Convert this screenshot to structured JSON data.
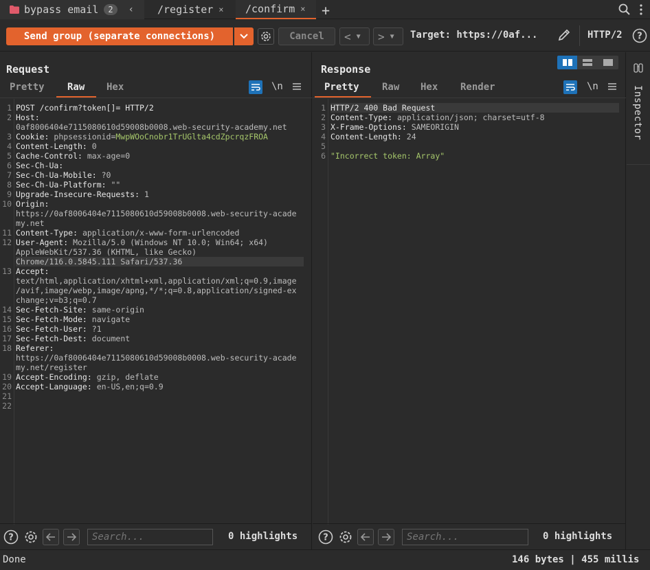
{
  "tabs": [
    {
      "label": "bypass email",
      "badge": "2"
    },
    {
      "label": "/register"
    },
    {
      "label": "/confirm"
    }
  ],
  "toolbar": {
    "send_label": "Send group (separate connections)",
    "cancel_label": "Cancel",
    "target_label": "Target: https://0af...",
    "http_version": "HTTP/2",
    "back_glyph": "<",
    "forward_glyph": ">"
  },
  "request": {
    "title": "Request",
    "subtabs": [
      "Pretty",
      "Raw",
      "Hex"
    ],
    "active_subtab": "Raw",
    "newline_toggle": "\\n",
    "lines": [
      {
        "n": "1",
        "k": "POST /confirm?token[]= HTTP/2",
        "v": ""
      },
      {
        "n": "2",
        "k": "Host:",
        "v": ""
      },
      {
        "n": "",
        "k": "",
        "v": "0af8006404e7115080610d59008b0008.web-security-academy.net"
      },
      {
        "n": "3",
        "k": "Cookie: ",
        "v": "phpsessionid=",
        "cv": "MwpWOoCnobr1TrUGlta4cdZpcrqzFROA"
      },
      {
        "n": "4",
        "k": "Content-Length: ",
        "v": "0"
      },
      {
        "n": "5",
        "k": "Cache-Control: ",
        "v": "max-age=0"
      },
      {
        "n": "6",
        "k": "Sec-Ch-Ua:",
        "v": ""
      },
      {
        "n": "7",
        "k": "Sec-Ch-Ua-Mobile: ",
        "v": "?0"
      },
      {
        "n": "8",
        "k": "Sec-Ch-Ua-Platform: ",
        "v": "\"\""
      },
      {
        "n": "9",
        "k": "Upgrade-Insecure-Requests: ",
        "v": "1"
      },
      {
        "n": "10",
        "k": "Origin:",
        "v": ""
      },
      {
        "n": "",
        "k": "",
        "v": "https://0af8006404e7115080610d59008b0008.web-security-acade"
      },
      {
        "n": "",
        "k": "",
        "v": "my.net"
      },
      {
        "n": "11",
        "k": "Content-Type: ",
        "v": "application/x-www-form-urlencoded"
      },
      {
        "n": "12",
        "k": "User-Agent: ",
        "v": "Mozilla/5.0 (Windows NT 10.0; Win64; x64)"
      },
      {
        "n": "",
        "k": "",
        "v": "AppleWebKit/537.36 (KHTML, like Gecko)"
      },
      {
        "n": "",
        "k": "",
        "v": "Chrome/116.0.5845.111 Safari/537.36"
      },
      {
        "n": "13",
        "k": "Accept:",
        "v": ""
      },
      {
        "n": "",
        "k": "",
        "v": "text/html,application/xhtml+xml,application/xml;q=0.9,image"
      },
      {
        "n": "",
        "k": "",
        "v": "/avif,image/webp,image/apng,*/*;q=0.8,application/signed-ex"
      },
      {
        "n": "",
        "k": "",
        "v": "change;v=b3;q=0.7"
      },
      {
        "n": "14",
        "k": "Sec-Fetch-Site: ",
        "v": "same-origin"
      },
      {
        "n": "15",
        "k": "Sec-Fetch-Mode: ",
        "v": "navigate"
      },
      {
        "n": "16",
        "k": "Sec-Fetch-User: ",
        "v": "?1"
      },
      {
        "n": "17",
        "k": "Sec-Fetch-Dest: ",
        "v": "document"
      },
      {
        "n": "18",
        "k": "Referer:",
        "v": ""
      },
      {
        "n": "",
        "k": "",
        "v": "https://0af8006404e7115080610d59008b0008.web-security-acade"
      },
      {
        "n": "",
        "k": "",
        "v": "my.net/register"
      },
      {
        "n": "19",
        "k": "Accept-Encoding: ",
        "v": "gzip, deflate"
      },
      {
        "n": "20",
        "k": "Accept-Language: ",
        "v": "en-US,en;q=0.9"
      },
      {
        "n": "21",
        "k": "",
        "v": ""
      },
      {
        "n": "22",
        "k": "",
        "v": ""
      }
    ],
    "search_placeholder": "Search...",
    "highlights": "0 highlights"
  },
  "response": {
    "title": "Response",
    "subtabs": [
      "Pretty",
      "Raw",
      "Hex",
      "Render"
    ],
    "active_subtab": "Pretty",
    "newline_toggle": "\\n",
    "lines": [
      {
        "n": "1",
        "k": "HTTP/2 400 Bad Request",
        "v": ""
      },
      {
        "n": "2",
        "k": "Content-Type: ",
        "v": "application/json; charset=utf-8"
      },
      {
        "n": "3",
        "k": "X-Frame-Options: ",
        "v": "SAMEORIGIN"
      },
      {
        "n": "4",
        "k": "Content-Length: ",
        "v": "24"
      },
      {
        "n": "5",
        "k": "",
        "v": ""
      },
      {
        "n": "6",
        "k": "",
        "v": "",
        "s": "\"Incorrect token: Array\""
      }
    ],
    "search_placeholder": "Search...",
    "highlights": "0 highlights"
  },
  "inspector": {
    "label": "Inspector"
  },
  "status": {
    "left": "Done",
    "right": "146 bytes | 455 millis"
  },
  "colors": {
    "accent": "#e3632d",
    "background": "#2b2b2b",
    "string": "#a6c76b",
    "layout_active": "#1e72b8"
  }
}
